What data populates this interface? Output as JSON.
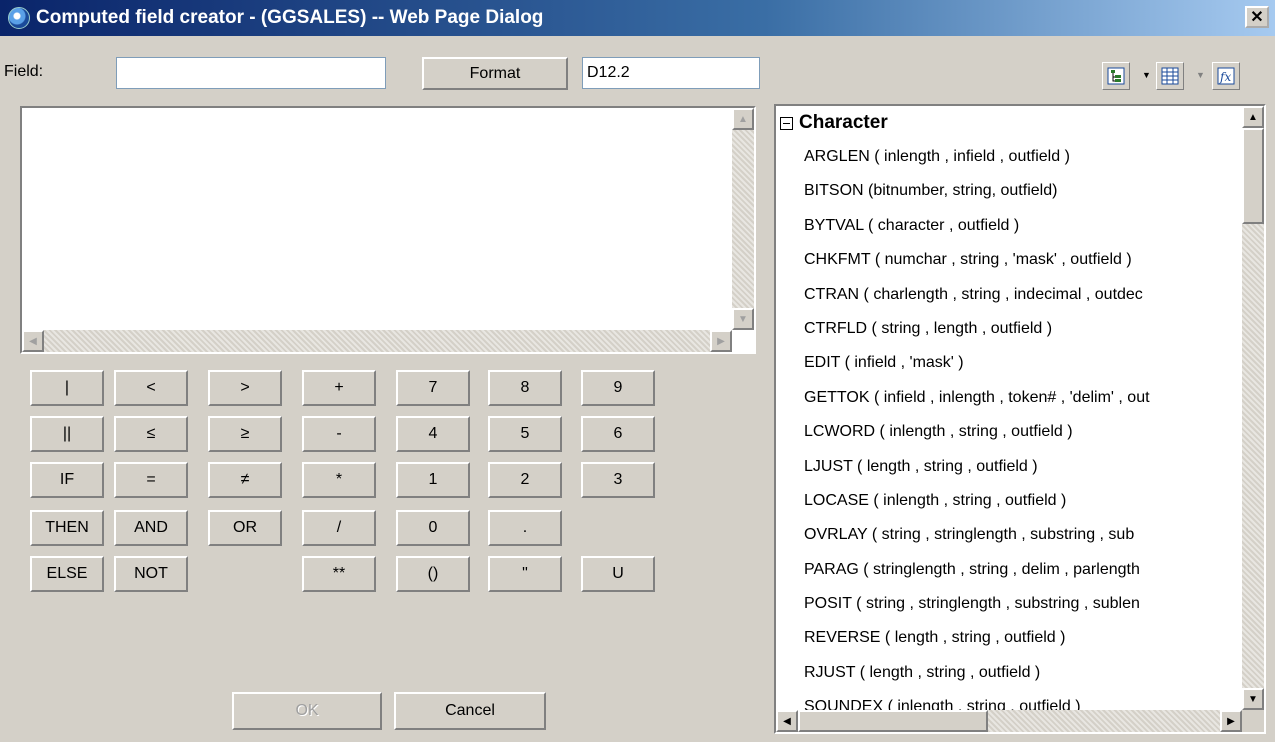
{
  "window": {
    "title": "Computed field creator - (GGSALES) -- Web Page Dialog",
    "close_label": "✕"
  },
  "toolbar": {
    "field_label": "Field:",
    "field_value": "",
    "format_button": "Format",
    "format_value": "D12.2",
    "icons": [
      "tree-view-icon",
      "columns-view-icon",
      "function-icon"
    ]
  },
  "keypad": {
    "rows": [
      [
        "|",
        "<",
        ">",
        "+",
        "7",
        "8",
        "9"
      ],
      [
        "||",
        "≤",
        "≥",
        "-",
        "4",
        "5",
        "6"
      ],
      [
        "IF",
        "=",
        "≠",
        "*",
        "1",
        "2",
        "3"
      ],
      [
        "THEN",
        "AND",
        "OR",
        "/",
        "0",
        "."
      ],
      [
        "ELSE",
        "NOT",
        "**",
        "()",
        "\"",
        "U"
      ]
    ]
  },
  "footer": {
    "ok_label": "OK",
    "cancel_label": "Cancel"
  },
  "functions": {
    "category": "Character",
    "items": [
      "ARGLEN ( inlength , infield , outfield )",
      "BITSON (bitnumber, string, outfield)",
      "BYTVAL ( character , outfield )",
      "CHKFMT ( numchar , string , 'mask' , outfield )",
      "CTRAN ( charlength , string , indecimal , outdec",
      "CTRFLD ( string , length , outfield )",
      "EDIT ( infield , 'mask' )",
      "GETTOK ( infield , inlength , token# , 'delim' , out",
      "LCWORD ( inlength , string , outfield )",
      "LJUST ( length , string , outfield )",
      "LOCASE ( inlength , string , outfield )",
      "OVRLAY ( string , stringlength , substring , sub",
      "PARAG ( stringlength , string , delim , parlength",
      "POSIT ( string , stringlength , substring , sublen",
      "REVERSE ( length , string , outfield )",
      "RJUST ( length , string , outfield )",
      "SOUNDEX ( inlength , string , outfield )"
    ]
  }
}
